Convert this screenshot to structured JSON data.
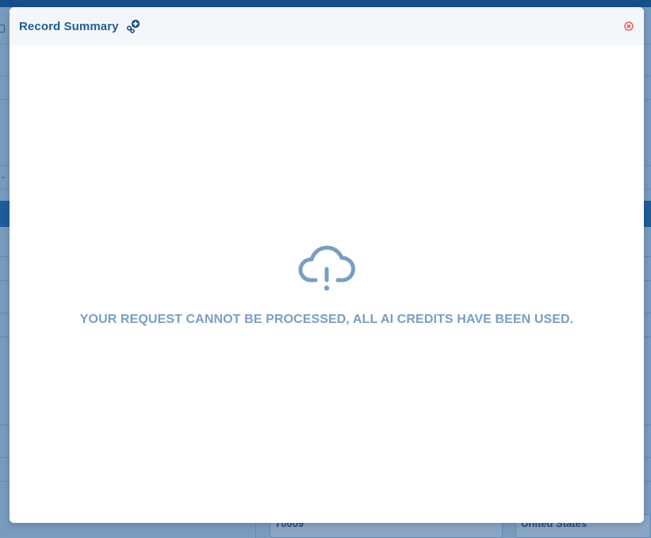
{
  "modal": {
    "title": "Record Summary",
    "title_icon": "ai-sparkle-icon",
    "close_icon": "close-circle-icon",
    "error_icon": "cloud-alert-icon",
    "message": "YOUR REQUEST CANNOT BE PROCESSED, ALL AI CREDITS HAVE BEEN USED."
  },
  "background": {
    "zip_value": "70009",
    "country_value": "United States"
  },
  "colors": {
    "header_bar": "#16528a",
    "title_text": "#1f5d97",
    "message_text": "#7a9ec4",
    "close_icon": "#e04848"
  }
}
